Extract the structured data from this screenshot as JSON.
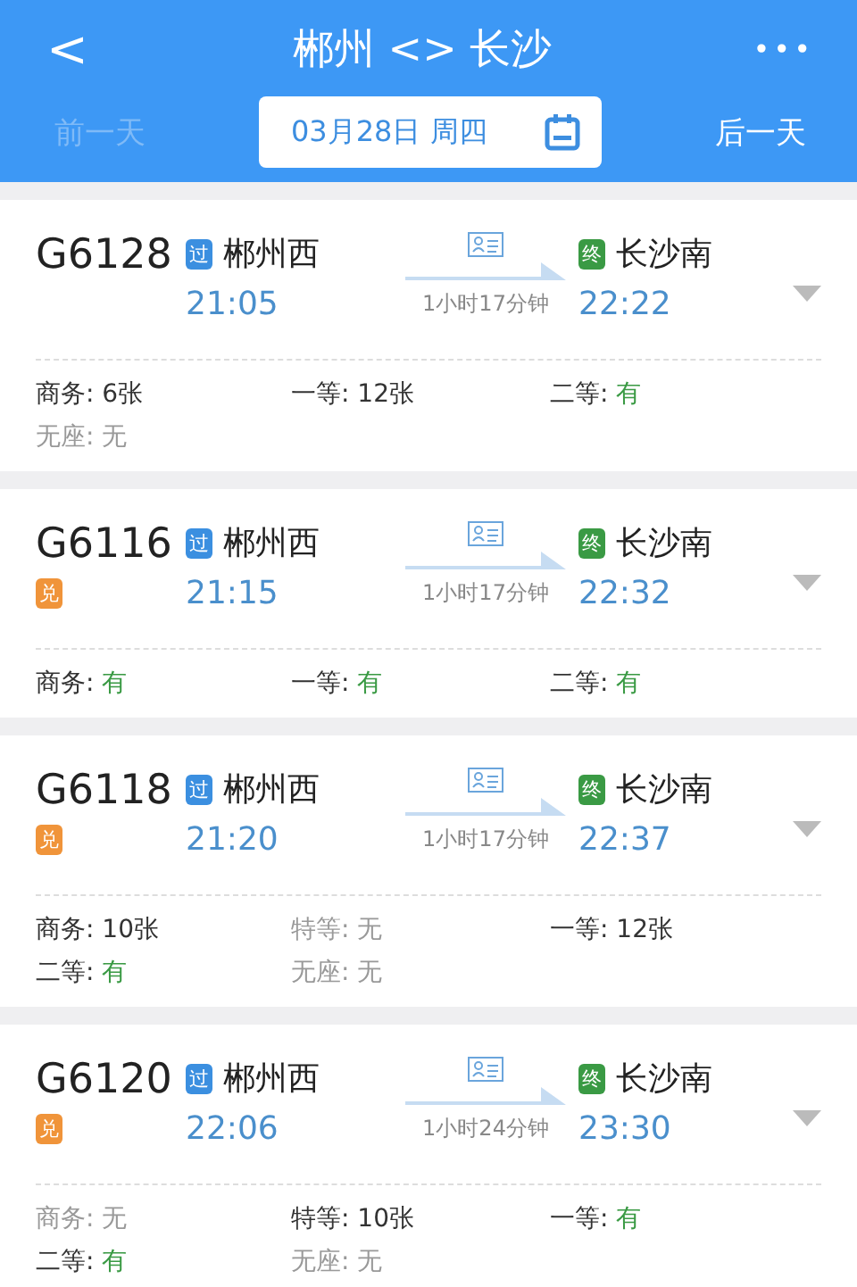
{
  "header": {
    "back": "<",
    "title": "郴州 <> 长沙",
    "more": "•••"
  },
  "date_bar": {
    "prev": {
      "label": "前一天",
      "disabled": true
    },
    "date": "03月28日 周四",
    "next": {
      "label": "后一天",
      "disabled": false
    }
  },
  "trains": [
    {
      "number": "G6128",
      "depart": {
        "badge": "过",
        "station": "郴州西",
        "time": "21:05"
      },
      "duration": "1小时17分钟",
      "arrive": {
        "badge": "终",
        "station": "长沙南",
        "time": "22:22"
      },
      "seats": [
        {
          "label": "商务:",
          "value": "6张",
          "kind": "count"
        },
        {
          "label": "一等:",
          "value": "12张",
          "kind": "count"
        },
        {
          "label": "二等:",
          "value": "有",
          "kind": "plenty"
        },
        {
          "label": "无座:",
          "value": "无",
          "kind": "none"
        }
      ]
    },
    {
      "number": "G6116",
      "tag": "兑",
      "depart": {
        "badge": "过",
        "station": "郴州西",
        "time": "21:15"
      },
      "duration": "1小时17分钟",
      "arrive": {
        "badge": "终",
        "station": "长沙南",
        "time": "22:32"
      },
      "seats": [
        {
          "label": "商务:",
          "value": "有",
          "kind": "plenty"
        },
        {
          "label": "一等:",
          "value": "有",
          "kind": "plenty"
        },
        {
          "label": "二等:",
          "value": "有",
          "kind": "plenty"
        }
      ]
    },
    {
      "number": "G6118",
      "tag": "兑",
      "depart": {
        "badge": "过",
        "station": "郴州西",
        "time": "21:20"
      },
      "duration": "1小时17分钟",
      "arrive": {
        "badge": "终",
        "station": "长沙南",
        "time": "22:37"
      },
      "seats": [
        {
          "label": "商务:",
          "value": "10张",
          "kind": "count"
        },
        {
          "label": "特等:",
          "value": "无",
          "kind": "none"
        },
        {
          "label": "一等:",
          "value": "12张",
          "kind": "count"
        },
        {
          "label": "二等:",
          "value": "有",
          "kind": "plenty"
        },
        {
          "label": "无座:",
          "value": "无",
          "kind": "none"
        }
      ]
    },
    {
      "number": "G6120",
      "tag": "兑",
      "depart": {
        "badge": "过",
        "station": "郴州西",
        "time": "22:06"
      },
      "duration": "1小时24分钟",
      "arrive": {
        "badge": "终",
        "station": "长沙南",
        "time": "23:30"
      },
      "seats": [
        {
          "label": "商务:",
          "value": "无",
          "kind": "none"
        },
        {
          "label": "特等:",
          "value": "10张",
          "kind": "count"
        },
        {
          "label": "一等:",
          "value": "有",
          "kind": "plenty"
        },
        {
          "label": "二等:",
          "value": "有",
          "kind": "plenty"
        },
        {
          "label": "无座:",
          "value": "无",
          "kind": "none"
        }
      ]
    }
  ]
}
